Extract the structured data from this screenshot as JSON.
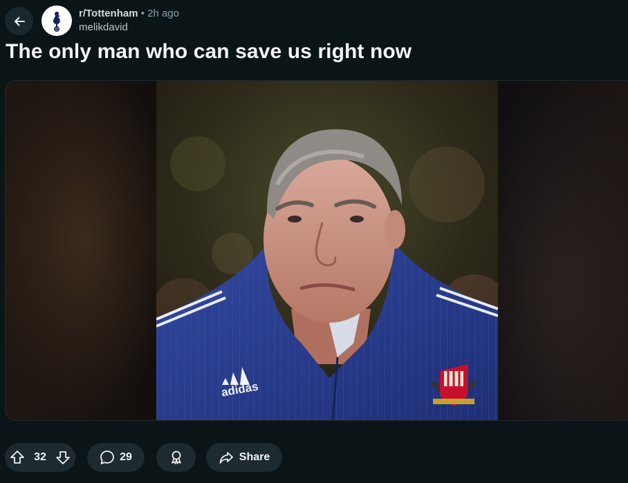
{
  "header": {
    "subreddit": "r/Tottenham",
    "separator": "•",
    "time": "2h ago",
    "username": "melikdavid"
  },
  "post": {
    "title": "The only man who can save us right now"
  },
  "actions": {
    "vote_count": "32",
    "comment_count": "29",
    "share_label": "Share"
  },
  "colors": {
    "background": "#0b1416",
    "pill": "#1d2a30",
    "jacket": "#2a3f8f"
  },
  "icons": [
    "back-arrow-icon",
    "tottenham-crest-icon",
    "upvote-icon",
    "downvote-icon",
    "comment-icon",
    "award-icon",
    "share-icon"
  ]
}
